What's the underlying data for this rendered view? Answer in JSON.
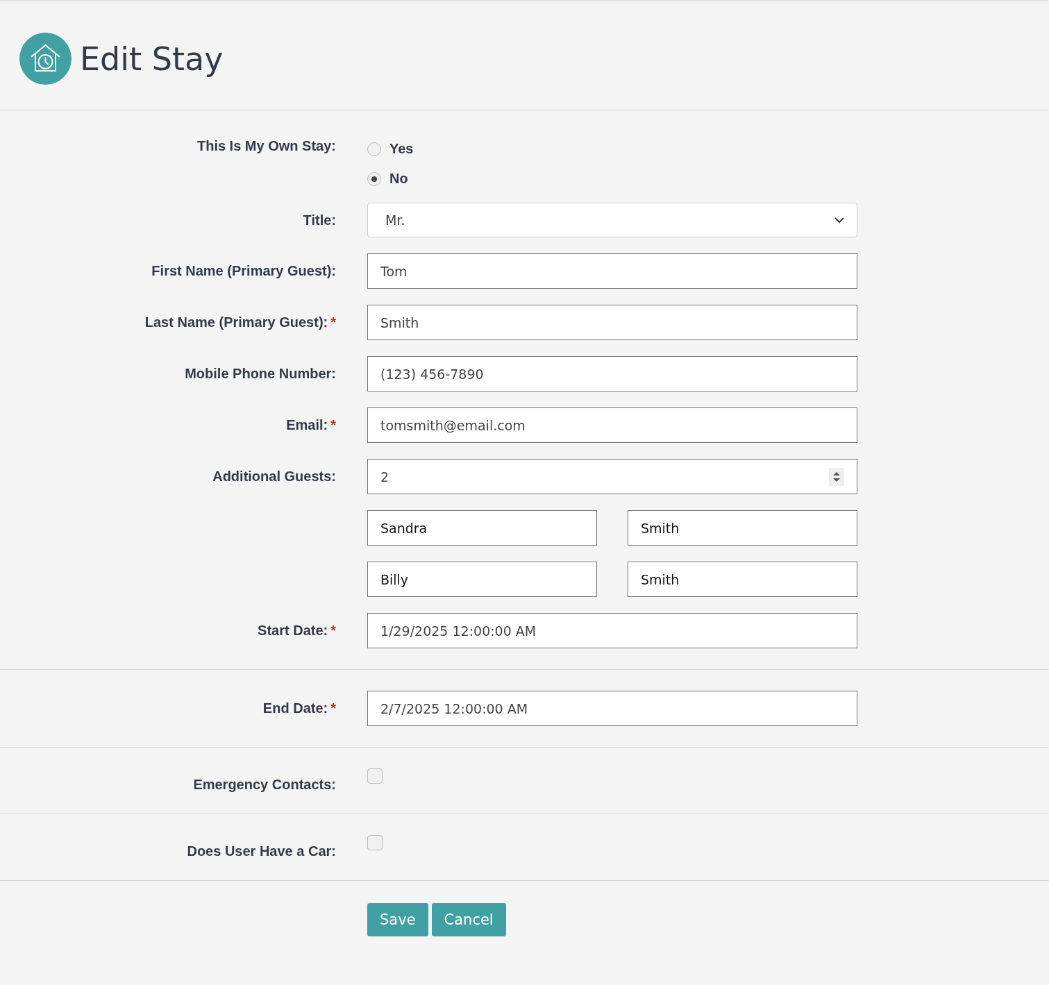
{
  "header": {
    "title": "Edit Stay"
  },
  "sections": [
    [
      {
        "kind": "radio",
        "label": "This Is My Own Stay:",
        "options": [
          {
            "label": "Yes",
            "selected": false
          },
          {
            "label": "No",
            "selected": true
          }
        ]
      },
      {
        "kind": "select",
        "label": "Title:",
        "value": "Mr."
      },
      {
        "kind": "text",
        "label": "First Name (Primary Guest):",
        "value": "Tom"
      },
      {
        "kind": "text",
        "label": "Last Name (Primary Guest):",
        "required_mark": "*",
        "value": "Smith"
      },
      {
        "kind": "text",
        "label": "Mobile Phone Number:",
        "value": "(123) 456-7890"
      },
      {
        "kind": "text",
        "label": "Email:",
        "required_mark": "*",
        "value": "tomsmith@email.com"
      },
      {
        "kind": "number",
        "label": "Additional Guests:",
        "value": "2"
      },
      {
        "kind": "pair",
        "first": "Sandra",
        "last": "Smith"
      },
      {
        "kind": "pair",
        "first": "Billy",
        "last": "Smith"
      },
      {
        "kind": "text",
        "label": "Start Date:",
        "required_mark": "*",
        "value": "1/29/2025 12:00:00 AM"
      }
    ],
    [
      {
        "kind": "text",
        "label": "End Date:",
        "required_mark": "*",
        "value": "2/7/2025 12:00:00 AM"
      }
    ],
    [
      {
        "kind": "checkbox",
        "label": "Emergency Contacts:",
        "checked": false
      }
    ],
    [
      {
        "kind": "checkbox",
        "label": "Does User Have a Car:",
        "checked": false
      }
    ]
  ],
  "buttons": [
    "Save",
    "Cancel"
  ]
}
